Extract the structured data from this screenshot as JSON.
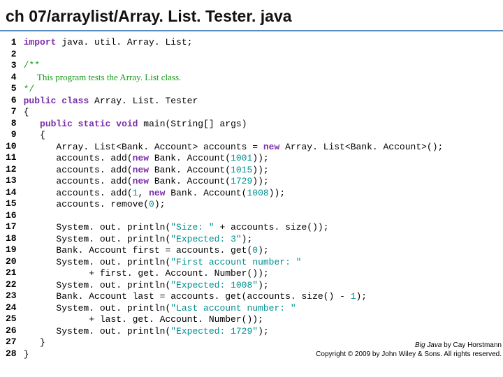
{
  "title": "ch 07/arraylist/Array. List. Tester. java",
  "gutter": " 1\n 2\n 3\n 4\n 5\n 6\n 7\n 8\n 9\n10\n11\n12\n13\n14\n15\n16\n17\n18\n19\n20\n21\n22\n23\n24\n25\n26\n27\n28",
  "tok": {
    "kw_import": "import",
    "t_pkg": " java. util. Array. List;",
    "cm_open": "/**",
    "doccm": "      This program tests the Array. List class.",
    "cm_close": "*/",
    "kw_public": "public",
    "kw_class": "class",
    "t_cls": " Array. List. Tester",
    "kw_static": "static",
    "kw_void": "void",
    "t_main": " main(String[] args)",
    "t_decl_a": "      Array. List<Bank. Account> accounts = ",
    "kw_new": "new",
    "t_decl_b": " Array. List<Bank. Account>();",
    "t_add_a": "      accounts. add(",
    "t_ba": " Bank. Account(",
    "n_1001": "1001",
    "t_close2": "));",
    "n_1015": "1015",
    "n_1729": "1729",
    "t_add1_a": "      accounts. add(",
    "n_1": "1",
    "t_comma_sp": ", ",
    "n_1008": "1008",
    "t_remove_a": "      accounts. remove(",
    "n_0": "0",
    "t_close1": ");",
    "t_sop": "      System. out. println(",
    "s_size": "\"Size: \"",
    "t_plus_size": " + accounts. size());",
    "s_exp3": "\"Expected: 3\"",
    "t_first_decl": "      Bank. Account first = accounts. get(",
    "s_firstacc": "\"First account number: \"",
    "t_plus_first": "            + first. get. Account. Number());",
    "s_exp1008": "\"Expected: 1008\"",
    "t_last_decl_a": "      Bank. Account last = accounts. get(accounts. size() - ",
    "s_lastacc": "\"Last account number: \"",
    "t_plus_last": "            + last. get. Account. Number());",
    "s_exp1729": "\"Expected: 1729\"",
    "t_brace_o": "{",
    "t_brace_c": "}",
    "t_brace_o_i": "   {",
    "t_brace_c_i": "   }",
    "sp3": "   "
  },
  "footer": {
    "bigjava": "Big Java",
    "by": " by Cay Horstmann",
    "copy": "Copyright © 2009 by John Wiley & Sons.  All rights reserved."
  }
}
